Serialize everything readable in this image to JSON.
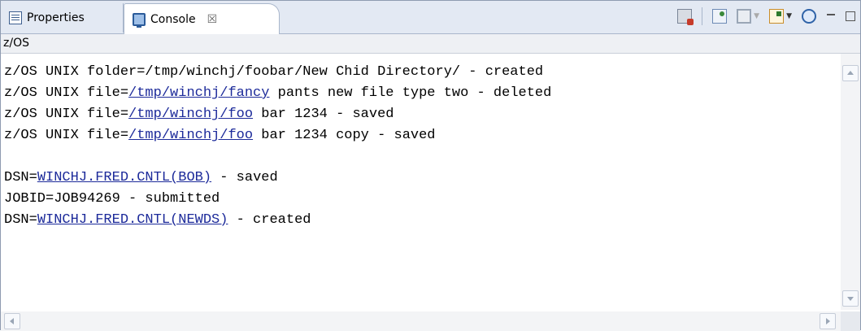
{
  "tabs": {
    "properties": {
      "label": "Properties",
      "icon": "properties-icon"
    },
    "console": {
      "label": "Console",
      "close": "☒",
      "icon": "console-icon"
    }
  },
  "toolbar": {
    "icons": [
      "clear-console-icon",
      "pin-console-icon",
      "display-console-icon",
      "open-console-icon",
      "remote-console-icon",
      "minimize-icon",
      "maximize-icon"
    ]
  },
  "console_label": "z/OS",
  "lines": [
    {
      "pre": "z/OS UNIX folder=/tmp/winchj/foobar/New Chid Directory/ - created"
    },
    {
      "pre": "z/OS UNIX file=",
      "link": "/tmp/winchj/fancy",
      "post": " pants new file type two - deleted"
    },
    {
      "pre": "z/OS UNIX file=",
      "link": "/tmp/winchj/foo",
      "post": " bar 1234 - saved"
    },
    {
      "pre": "z/OS UNIX file=",
      "link": "/tmp/winchj/foo",
      "post": " bar 1234 copy - saved"
    },
    {
      "pre": ""
    },
    {
      "pre": "DSN=",
      "link": "WINCHJ.FRED.CNTL(BOB)",
      "post": " - saved"
    },
    {
      "pre": "JOBID=JOB94269 - submitted"
    },
    {
      "pre": "DSN=",
      "link": "WINCHJ.FRED.CNTL(NEWDS)",
      "post": " - created"
    }
  ],
  "colors": {
    "link": "#1c2a9a",
    "tabbar": "#e3e9f3",
    "border": "#8e9bb0"
  }
}
